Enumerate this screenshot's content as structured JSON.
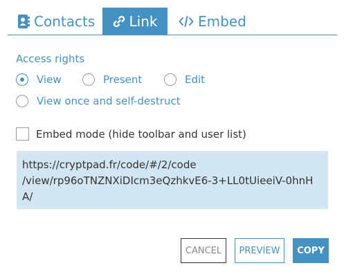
{
  "tabs": [
    {
      "label": "Contacts",
      "icon": "address-book-icon",
      "active": false
    },
    {
      "label": "Link",
      "icon": "link-icon",
      "active": true
    },
    {
      "label": "Embed",
      "icon": "code-icon",
      "active": false
    }
  ],
  "access": {
    "label": "Access rights",
    "options": [
      {
        "label": "View",
        "selected": true
      },
      {
        "label": "Present",
        "selected": false
      },
      {
        "label": "Edit",
        "selected": false
      },
      {
        "label": "View once and self-destruct",
        "selected": false
      }
    ]
  },
  "embed_mode": {
    "label": "Embed mode (hide toolbar and user list)",
    "checked": false
  },
  "link_text": "https://cryptpad.fr/code/#/2/code\n/view/rp96oTNZNXiDIcm3eQzhkvE6-3+LL0tUieeiV-0hnHA/",
  "buttons": {
    "cancel": "CANCEL",
    "preview": "PREVIEW",
    "copy": "COPY"
  },
  "colors": {
    "accent": "#4591c4",
    "link_bg": "#d1e5f2"
  }
}
